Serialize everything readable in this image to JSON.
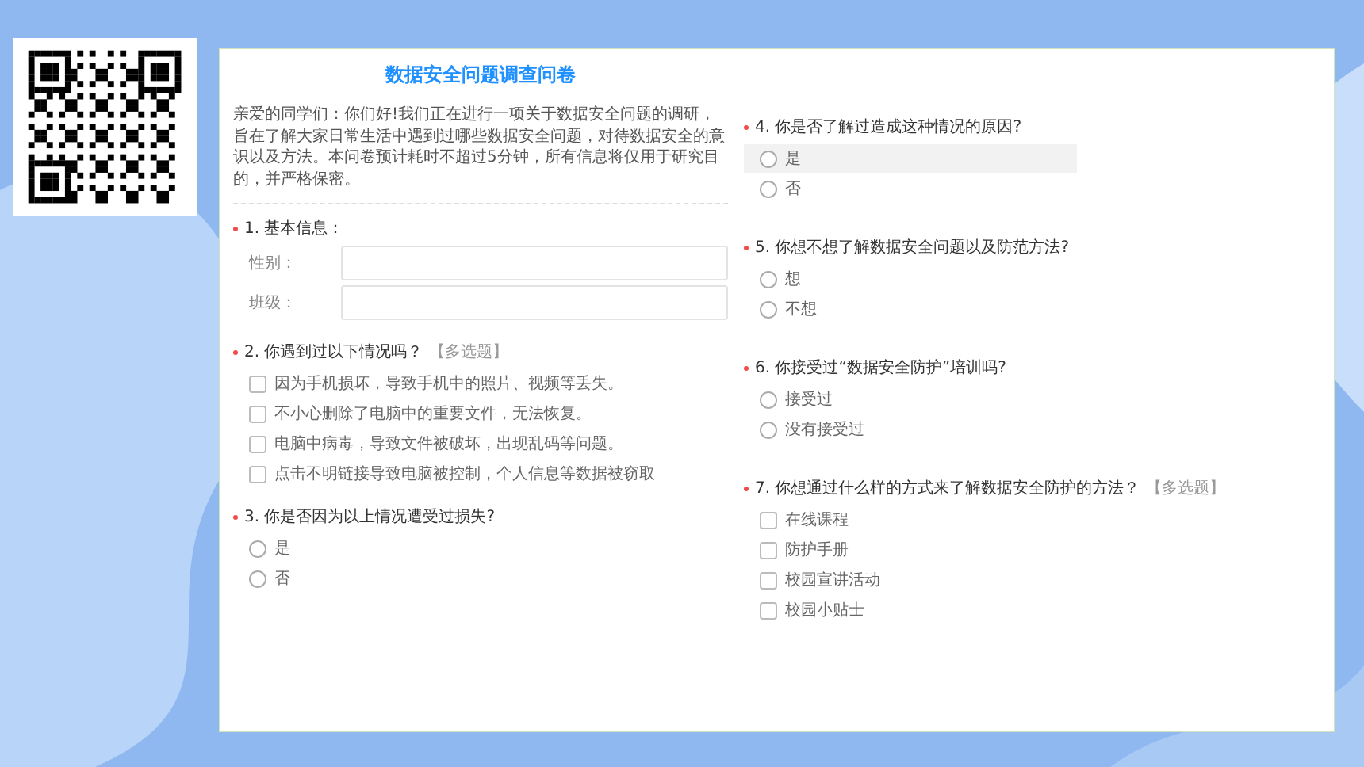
{
  "survey": {
    "title": "数据安全问题调查问卷",
    "intro": "亲爱的同学们：你们好!我们正在进行一项关于数据安全问题的调研，旨在了解大家日常生活中遇到过哪些数据安全问题，对待数据安全的意识以及方法。本问卷预计耗时不超过5分钟，所有信息将仅用于研究目的，并严格保密。"
  },
  "columns": [
    {
      "questions": [
        {
          "kind": "fields",
          "required": true,
          "label": "1. 基本信息：",
          "fields": [
            {
              "label": "性别："
            },
            {
              "label": "班级："
            }
          ]
        },
        {
          "kind": "checkbox",
          "required": true,
          "label": "2. 你遇到过以下情况吗？",
          "tag": "【多选题】",
          "options": [
            {
              "label": "因为手机损坏，导致手机中的照片、视频等丢失。",
              "checked": false,
              "highlighted": false
            },
            {
              "label": "不小心删除了电脑中的重要文件，无法恢复。",
              "checked": false,
              "highlighted": false
            },
            {
              "label": "电脑中病毒，导致文件被破坏，出现乱码等问题。",
              "checked": false,
              "highlighted": false
            },
            {
              "label": "点击不明链接导致电脑被控制，个人信息等数据被窃取",
              "checked": false,
              "highlighted": false
            }
          ]
        },
        {
          "kind": "radio",
          "required": true,
          "label": "3. 你是否因为以上情况遭受过损失?",
          "options": [
            {
              "label": "是",
              "selected": false,
              "highlighted": false
            },
            {
              "label": "否",
              "selected": false,
              "highlighted": false
            }
          ]
        }
      ]
    },
    {
      "questions": [
        {
          "kind": "radio",
          "required": true,
          "label": "4. 你是否了解过造成这种情况的原因?",
          "options": [
            {
              "label": "是",
              "selected": false,
              "highlighted": true
            },
            {
              "label": "否",
              "selected": false,
              "highlighted": false
            }
          ]
        },
        {
          "kind": "radio",
          "required": true,
          "label": "5. 你想不想了解数据安全问题以及防范方法?",
          "options": [
            {
              "label": "想",
              "selected": false,
              "highlighted": false
            },
            {
              "label": "不想",
              "selected": false,
              "highlighted": false
            }
          ]
        },
        {
          "kind": "radio",
          "required": true,
          "label": "6. 你接受过“数据安全防护”培训吗?",
          "options": [
            {
              "label": "接受过",
              "selected": false,
              "highlighted": false
            },
            {
              "label": "没有接受过",
              "selected": false,
              "highlighted": false
            }
          ]
        },
        {
          "kind": "checkbox",
          "required": true,
          "label": "7. 你想通过什么样的方式来了解数据安全防护的方法？",
          "tag": "【多选题】",
          "options": [
            {
              "label": "在线课程",
              "checked": false,
              "highlighted": false
            },
            {
              "label": "防护手册",
              "checked": false,
              "highlighted": false
            },
            {
              "label": "校园宣讲活动",
              "checked": false,
              "highlighted": false
            },
            {
              "label": "校园小贴士",
              "checked": false,
              "highlighted": false
            }
          ]
        }
      ]
    }
  ]
}
